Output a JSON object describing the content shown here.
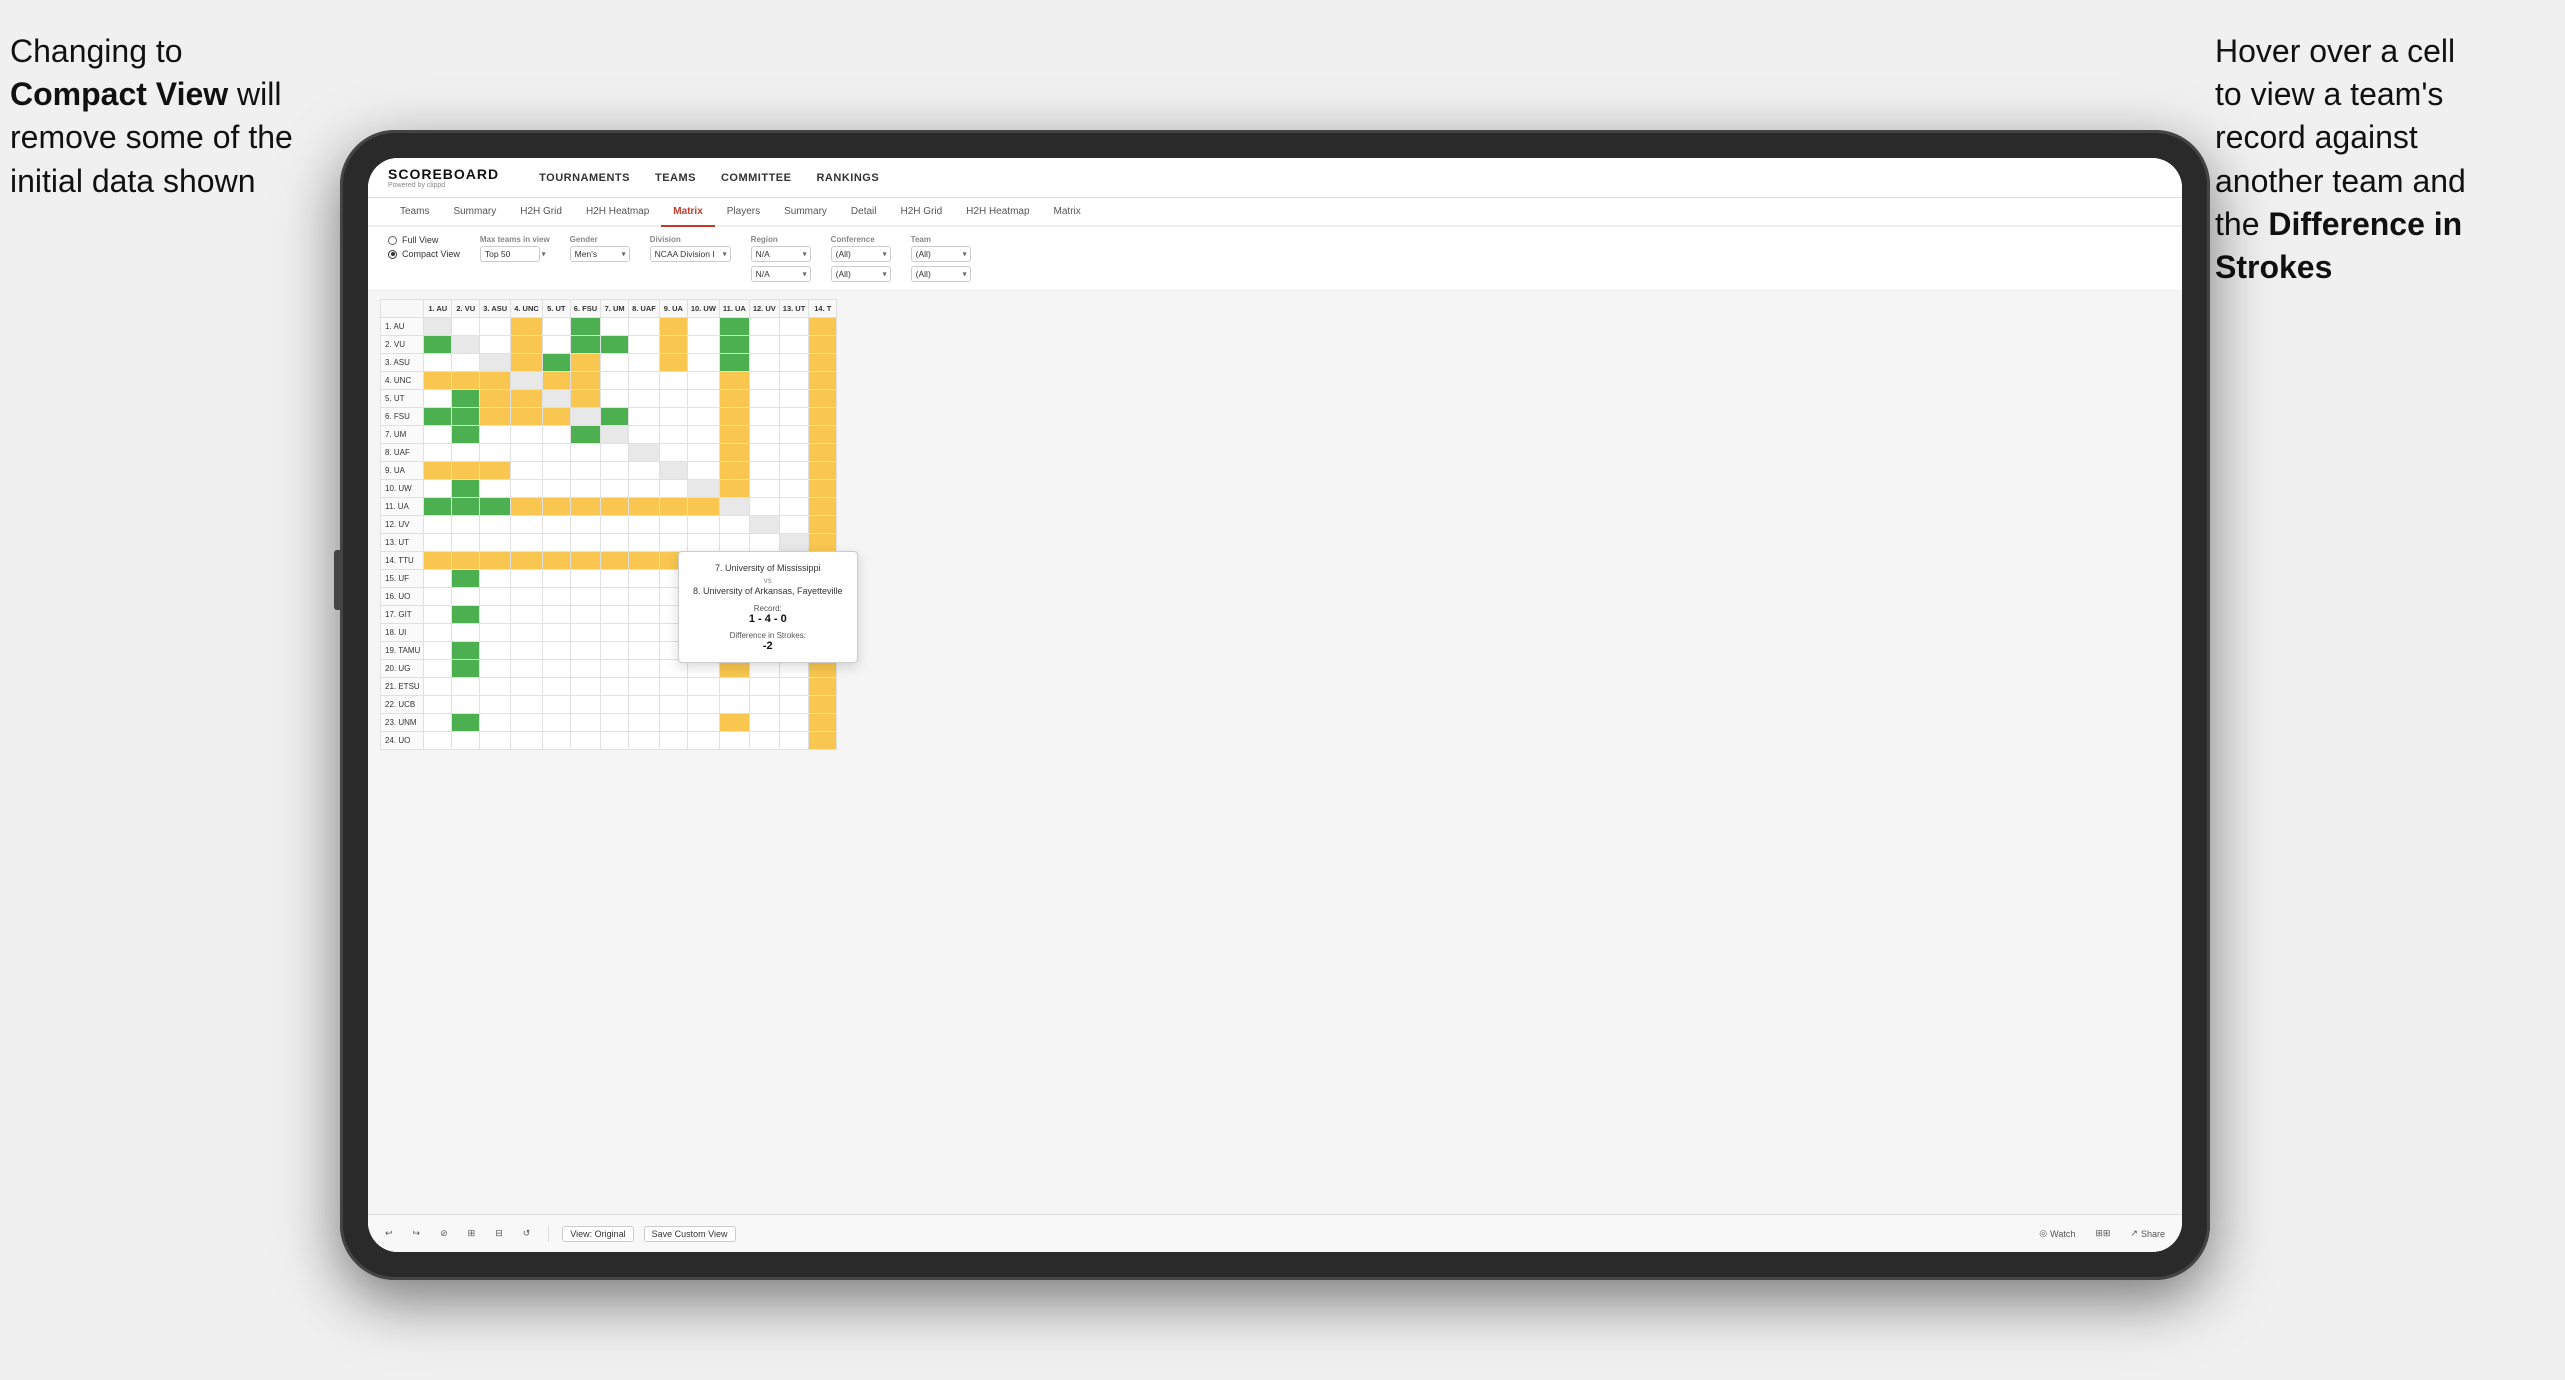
{
  "annotations": {
    "left": {
      "line1": "Changing to",
      "line2_bold": "Compact View",
      "line2_rest": " will",
      "line3": "remove some of the",
      "line4": "initial data shown"
    },
    "right": {
      "line1": "Hover over a cell",
      "line2": "to view a team's",
      "line3": "record against",
      "line4": "another team and",
      "line5_pre": "the ",
      "line5_bold": "Difference in",
      "line6_bold": "Strokes"
    }
  },
  "nav": {
    "logo": "SCOREBOARD",
    "logo_sub": "Powered by clippd",
    "items": [
      "TOURNAMENTS",
      "TEAMS",
      "COMMITTEE",
      "RANKINGS"
    ]
  },
  "sub_nav": {
    "tabs": [
      "Teams",
      "Summary",
      "H2H Grid",
      "H2H Heatmap",
      "Matrix",
      "Players",
      "Summary",
      "Detail",
      "H2H Grid",
      "H2H Heatmap",
      "Matrix"
    ]
  },
  "filters": {
    "view_options": [
      "Full View",
      "Compact View"
    ],
    "selected_view": "Compact View",
    "groups": [
      {
        "label": "Max teams in view",
        "value": "Top 50"
      },
      {
        "label": "Gender",
        "value": "Men's"
      },
      {
        "label": "Division",
        "value": "NCAA Division I"
      },
      {
        "label": "Region",
        "value": "N/A"
      },
      {
        "label": "Conference",
        "value": "(All)"
      },
      {
        "label": "",
        "value": "N/A"
      },
      {
        "label": "",
        "value": "(All)"
      },
      {
        "label": "Team",
        "value": "(All)"
      },
      {
        "label": "",
        "value": "(All)"
      }
    ]
  },
  "matrix": {
    "col_headers": [
      "1. AU",
      "2. VU",
      "3. ASU",
      "4. UNC",
      "5. UT",
      "6. FSU",
      "7. UM",
      "8. UAF",
      "9. UA",
      "10. UW",
      "11. UA",
      "12. UV",
      "13. UT",
      "14. T"
    ],
    "rows": [
      {
        "name": "1. AU",
        "cells": [
          "self",
          "white",
          "white",
          "yellow",
          "white",
          "green",
          "white",
          "white",
          "yellow",
          "white",
          "green",
          "white",
          "white",
          "yellow"
        ]
      },
      {
        "name": "2. VU",
        "cells": [
          "green",
          "self",
          "white",
          "yellow",
          "white",
          "green",
          "green",
          "white",
          "yellow",
          "white",
          "green",
          "white",
          "white",
          "yellow"
        ]
      },
      {
        "name": "3. ASU",
        "cells": [
          "white",
          "white",
          "self",
          "yellow",
          "green",
          "yellow",
          "white",
          "white",
          "yellow",
          "white",
          "green",
          "white",
          "white",
          "yellow"
        ]
      },
      {
        "name": "4. UNC",
        "cells": [
          "yellow",
          "yellow",
          "yellow",
          "self",
          "yellow",
          "yellow",
          "white",
          "white",
          "white",
          "white",
          "yellow",
          "white",
          "white",
          "yellow"
        ]
      },
      {
        "name": "5. UT",
        "cells": [
          "white",
          "green",
          "yellow",
          "yellow",
          "self",
          "yellow",
          "white",
          "white",
          "white",
          "white",
          "yellow",
          "white",
          "white",
          "yellow"
        ]
      },
      {
        "name": "6. FSU",
        "cells": [
          "green",
          "green",
          "yellow",
          "yellow",
          "yellow",
          "self",
          "green",
          "white",
          "white",
          "white",
          "yellow",
          "white",
          "white",
          "yellow"
        ]
      },
      {
        "name": "7. UM",
        "cells": [
          "white",
          "green",
          "white",
          "white",
          "white",
          "green",
          "self",
          "white",
          "white",
          "white",
          "yellow",
          "white",
          "white",
          "yellow"
        ]
      },
      {
        "name": "8. UAF",
        "cells": [
          "white",
          "white",
          "white",
          "white",
          "white",
          "white",
          "white",
          "self",
          "white",
          "white",
          "yellow",
          "white",
          "white",
          "yellow"
        ]
      },
      {
        "name": "9. UA",
        "cells": [
          "yellow",
          "yellow",
          "yellow",
          "white",
          "white",
          "white",
          "white",
          "white",
          "self",
          "white",
          "yellow",
          "white",
          "white",
          "yellow"
        ]
      },
      {
        "name": "10. UW",
        "cells": [
          "white",
          "green",
          "white",
          "white",
          "white",
          "white",
          "white",
          "white",
          "white",
          "self",
          "yellow",
          "white",
          "white",
          "yellow"
        ]
      },
      {
        "name": "11. UA",
        "cells": [
          "green",
          "green",
          "green",
          "yellow",
          "yellow",
          "yellow",
          "yellow",
          "yellow",
          "yellow",
          "yellow",
          "self",
          "white",
          "white",
          "yellow"
        ]
      },
      {
        "name": "12. UV",
        "cells": [
          "white",
          "white",
          "white",
          "white",
          "white",
          "white",
          "white",
          "white",
          "white",
          "white",
          "white",
          "self",
          "white",
          "yellow"
        ]
      },
      {
        "name": "13. UT",
        "cells": [
          "white",
          "white",
          "white",
          "white",
          "white",
          "white",
          "white",
          "white",
          "white",
          "white",
          "white",
          "white",
          "self",
          "yellow"
        ]
      },
      {
        "name": "14. TTU",
        "cells": [
          "yellow",
          "yellow",
          "yellow",
          "yellow",
          "yellow",
          "yellow",
          "yellow",
          "yellow",
          "yellow",
          "yellow",
          "yellow",
          "yellow",
          "yellow",
          "self"
        ]
      },
      {
        "name": "15. UF",
        "cells": [
          "white",
          "green",
          "white",
          "white",
          "white",
          "white",
          "white",
          "white",
          "white",
          "white",
          "yellow",
          "white",
          "white",
          "yellow"
        ]
      },
      {
        "name": "16. UO",
        "cells": [
          "white",
          "white",
          "white",
          "white",
          "white",
          "white",
          "white",
          "white",
          "white",
          "white",
          "white",
          "white",
          "white",
          "yellow"
        ]
      },
      {
        "name": "17. GIT",
        "cells": [
          "white",
          "green",
          "white",
          "white",
          "white",
          "white",
          "white",
          "white",
          "white",
          "white",
          "yellow",
          "white",
          "white",
          "yellow"
        ]
      },
      {
        "name": "18. UI",
        "cells": [
          "white",
          "white",
          "white",
          "white",
          "white",
          "white",
          "white",
          "white",
          "white",
          "white",
          "white",
          "white",
          "white",
          "yellow"
        ]
      },
      {
        "name": "19. TAMU",
        "cells": [
          "white",
          "green",
          "white",
          "white",
          "white",
          "white",
          "white",
          "white",
          "white",
          "white",
          "yellow",
          "white",
          "white",
          "yellow"
        ]
      },
      {
        "name": "20. UG",
        "cells": [
          "white",
          "green",
          "white",
          "white",
          "white",
          "white",
          "white",
          "white",
          "white",
          "white",
          "yellow",
          "white",
          "white",
          "yellow"
        ]
      },
      {
        "name": "21. ETSU",
        "cells": [
          "white",
          "white",
          "white",
          "white",
          "white",
          "white",
          "white",
          "white",
          "white",
          "white",
          "white",
          "white",
          "white",
          "yellow"
        ]
      },
      {
        "name": "22. UCB",
        "cells": [
          "white",
          "white",
          "white",
          "white",
          "white",
          "white",
          "white",
          "white",
          "white",
          "white",
          "white",
          "white",
          "white",
          "yellow"
        ]
      },
      {
        "name": "23. UNM",
        "cells": [
          "white",
          "green",
          "white",
          "white",
          "white",
          "white",
          "white",
          "white",
          "white",
          "white",
          "yellow",
          "white",
          "white",
          "yellow"
        ]
      },
      {
        "name": "24. UO",
        "cells": [
          "white",
          "white",
          "white",
          "white",
          "white",
          "white",
          "white",
          "white",
          "white",
          "white",
          "white",
          "white",
          "white",
          "yellow"
        ]
      }
    ]
  },
  "tooltip": {
    "team1": "7. University of Mississippi",
    "vs": "vs",
    "team2": "8. University of Arkansas, Fayetteville",
    "record_label": "Record:",
    "record_value": "1 - 4 - 0",
    "strokes_label": "Difference in Strokes:",
    "strokes_value": "-2"
  },
  "toolbar": {
    "buttons": [
      "↩",
      "↪",
      "⊘",
      "⊞",
      "⊟",
      "↺"
    ],
    "view_original": "View: Original",
    "save_custom": "Save Custom View",
    "watch": "Watch",
    "share": "Share"
  }
}
